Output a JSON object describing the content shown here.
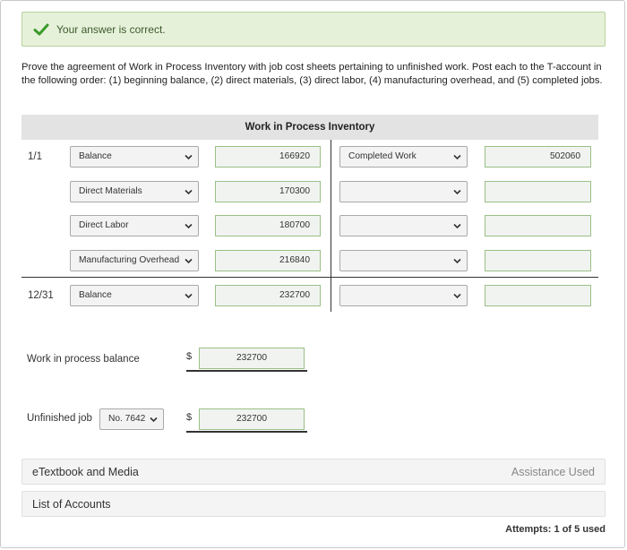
{
  "feedback": {
    "message": "Your answer is correct.",
    "icon": "check-icon",
    "color": "#3a9a2a"
  },
  "instructions": "Prove the agreement of Work in Process Inventory with job cost sheets pertaining to unfinished work. Post each to the T-account in the following order: (1) beginning balance, (2) direct materials, (3) direct labor, (4) manufacturing overhead, and (5) completed jobs.",
  "t_account": {
    "title": "Work in Process Inventory",
    "debit_rows": [
      {
        "date": "1/1",
        "account": "Balance",
        "amount": "166920"
      },
      {
        "date": "",
        "account": "Direct Materials",
        "amount": "170300"
      },
      {
        "date": "",
        "account": "Direct Labor",
        "amount": "180700"
      },
      {
        "date": "",
        "account": "Manufacturing Overhead",
        "amount": "216840"
      },
      {
        "date": "12/31",
        "account": "Balance",
        "amount": "232700"
      }
    ],
    "credit_rows": [
      {
        "account": "Completed Work",
        "amount": "502060"
      },
      {
        "account": "",
        "amount": ""
      },
      {
        "account": "",
        "amount": ""
      },
      {
        "account": "",
        "amount": ""
      },
      {
        "account": "",
        "amount": ""
      }
    ]
  },
  "wip_balance": {
    "label": "Work in process balance",
    "currency": "$",
    "value": "232700"
  },
  "unfinished_job": {
    "label": "Unfinished job",
    "job": "No. 7642",
    "currency": "$",
    "value": "232700"
  },
  "panels": {
    "etextbook": {
      "title": "eTextbook and Media",
      "right": "Assistance Used"
    },
    "accounts": {
      "title": "List of Accounts"
    }
  },
  "attempts": "Attempts: 1 of 5 used"
}
